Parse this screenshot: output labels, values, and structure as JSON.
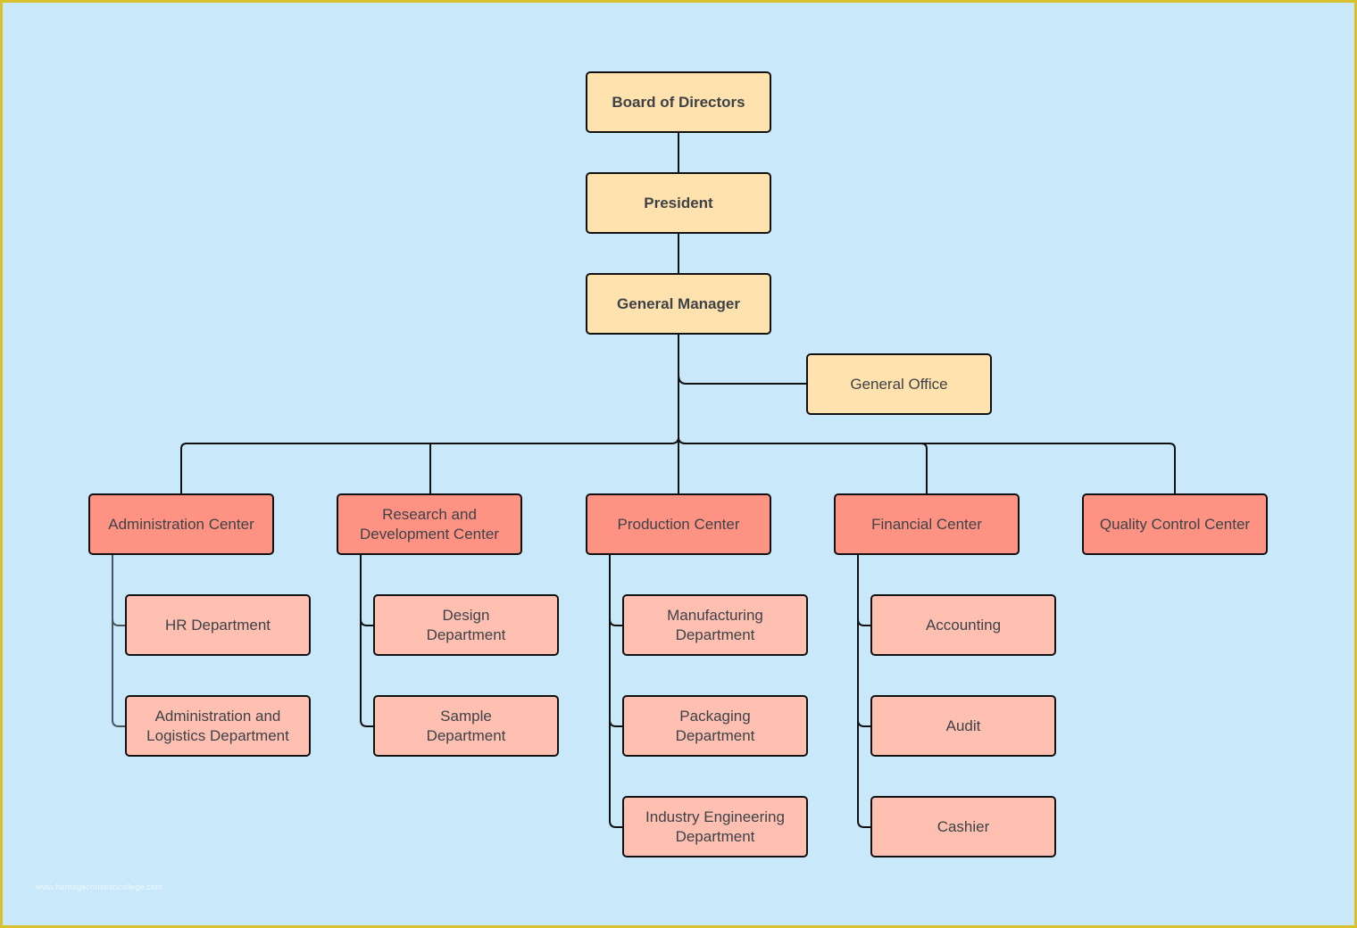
{
  "chart": {
    "type": "org-chart",
    "colors": {
      "background": "#c9e9fb",
      "frame_border": "#d8c12e",
      "executive_fill": "#ffe2ad",
      "center_fill": "#fe9384",
      "department_fill": "#ffc0b2",
      "text": "#3e4247",
      "connector": "#111111"
    },
    "executives": [
      {
        "id": "board",
        "label": "Board of Directors"
      },
      {
        "id": "president",
        "label": "President",
        "reports_to": "board"
      },
      {
        "id": "gm",
        "label": "General Manager",
        "reports_to": "president"
      }
    ],
    "staff_office": {
      "id": "general-office",
      "label": "General Office",
      "reports_to": "gm"
    },
    "centers": [
      {
        "id": "admin",
        "label": "Administration Center",
        "reports_to": "gm",
        "departments": [
          "HR Department",
          "Administration and Logistics Department"
        ]
      },
      {
        "id": "rnd",
        "label": "Research and Development Center",
        "reports_to": "gm",
        "departments": [
          "Design Department",
          "Sample Department"
        ]
      },
      {
        "id": "production",
        "label": "Production Center",
        "reports_to": "gm",
        "departments": [
          "Manufacturing Department",
          "Packaging Department",
          "Industry Engineering Department"
        ]
      },
      {
        "id": "financial",
        "label": "Financial Center",
        "reports_to": "gm",
        "departments": [
          "Accounting",
          "Audit",
          "Cashier"
        ]
      },
      {
        "id": "quality",
        "label": "Quality Control Center",
        "reports_to": "gm",
        "departments": []
      }
    ]
  },
  "labels": {
    "board": "Board of Directors",
    "president": "President",
    "gm": "General Manager",
    "general_office": "General Office",
    "admin": "Administration Center",
    "rnd": "Research and Development Center",
    "production": "Production Center",
    "financial": "Financial Center",
    "quality": "Quality Control Center",
    "hr": "HR Department",
    "admin_logistics": "Administration and Logistics Department",
    "design": "Design Department",
    "sample": "Sample Department",
    "manufacturing": "Manufacturing Department",
    "packaging": "Packaging Department",
    "industry_eng": "Industry Engineering Department",
    "accounting": "Accounting",
    "audit": "Audit",
    "cashier": "Cashier"
  },
  "watermark": "www.heritagechristiancollege.com"
}
